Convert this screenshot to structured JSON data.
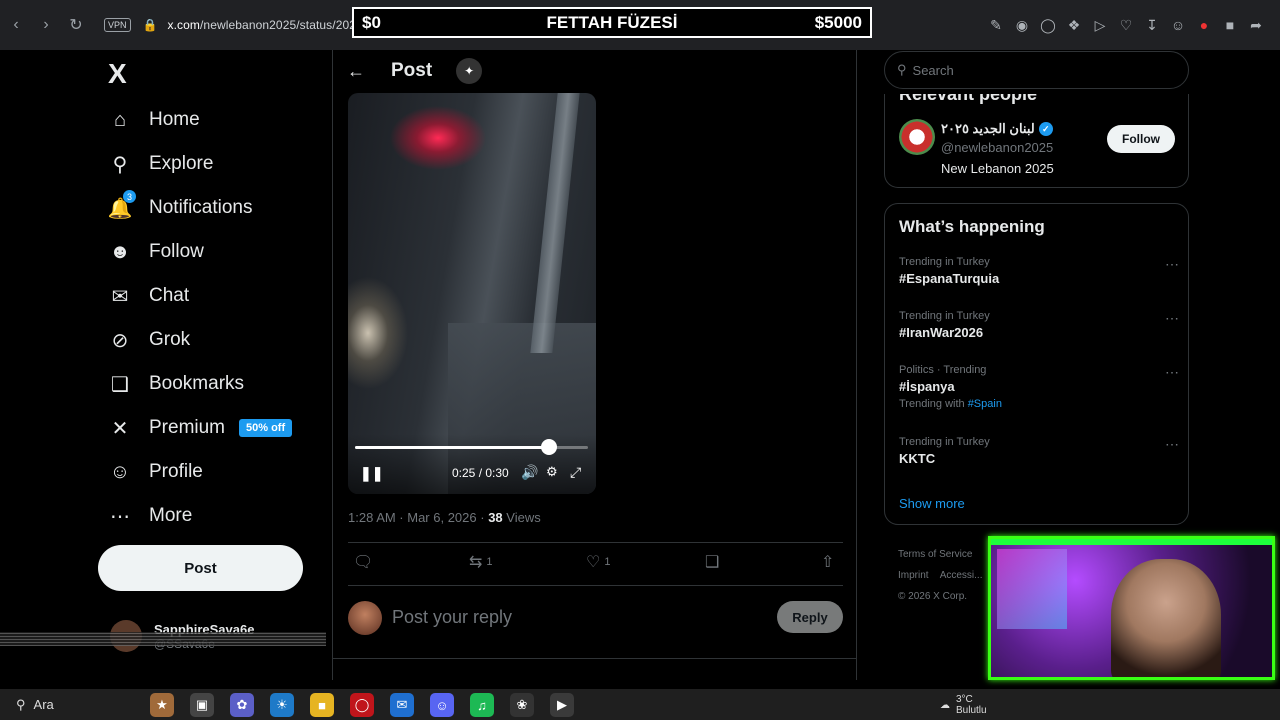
{
  "browser": {
    "vpn_label": "VPN",
    "url_domain": "x.com",
    "url_path": "/newlebanon2025/status/2029...3621429296"
  },
  "banner": {
    "left_amount": "$0",
    "title": "FETTAH FÜZESİ",
    "right_amount": "$5000"
  },
  "sidebar": {
    "logo": "X",
    "items": [
      {
        "label": "Home",
        "icon": "home-icon"
      },
      {
        "label": "Explore",
        "icon": "search-icon"
      },
      {
        "label": "Notifications",
        "icon": "bell-icon",
        "badge": "3"
      },
      {
        "label": "Follow",
        "icon": "person-add-icon"
      },
      {
        "label": "Chat",
        "icon": "mail-icon"
      },
      {
        "label": "Grok",
        "icon": "grok-icon"
      },
      {
        "label": "Bookmarks",
        "icon": "bookmark-icon"
      },
      {
        "label": "Premium",
        "icon": "x-premium-icon",
        "badge": "50% off"
      },
      {
        "label": "Profile",
        "icon": "profile-icon"
      },
      {
        "label": "More",
        "icon": "more-circle-icon"
      }
    ],
    "post_button": "Post",
    "account": {
      "name": "SapphireSava6e",
      "handle": "@SSava6e"
    }
  },
  "post": {
    "header_title": "Post",
    "video": {
      "time_display": "0:25 / 0:30",
      "progress": 0.8333
    },
    "timestamp": "1:28 AM · Mar 6, 2026 · ",
    "views_count": "38",
    "views_label": " Views",
    "actions": {
      "reply_count": "",
      "repost_count": "1",
      "like_count": "1"
    },
    "reply_placeholder": "Post your reply",
    "reply_button": "Reply"
  },
  "right": {
    "search_placeholder": "Search",
    "relevant_title": "Relevant people",
    "relevant_person": {
      "name": "لبنان الجديد ٢٠٢٥",
      "handle": "@newlebanon2025",
      "bio": "New Lebanon 2025",
      "follow_label": "Follow"
    },
    "trends_title": "What’s happening",
    "trends": [
      {
        "context": "Trending in Turkey",
        "tag": "#EspanaTurquia",
        "with": ""
      },
      {
        "context": "Trending in Turkey",
        "tag": "#IranWar2026",
        "with": ""
      },
      {
        "context": "Politics · Trending",
        "tag": "#İspanya",
        "with_prefix": "Trending with ",
        "with": "#Spain"
      },
      {
        "context": "Trending in Turkey",
        "tag": "KKTC",
        "with": ""
      }
    ],
    "show_more": "Show more",
    "footer": [
      "Terms of Service",
      "Imprint",
      "Accessi...",
      "© 2026 X Corp."
    ]
  },
  "taskbar": {
    "search_label": "Ara",
    "weather_temp": "3°C",
    "weather_desc": "Bulutlu"
  },
  "colors": {
    "accent": "#1d9bf0",
    "background": "#000000",
    "webcam_frame": "#39ff14"
  }
}
